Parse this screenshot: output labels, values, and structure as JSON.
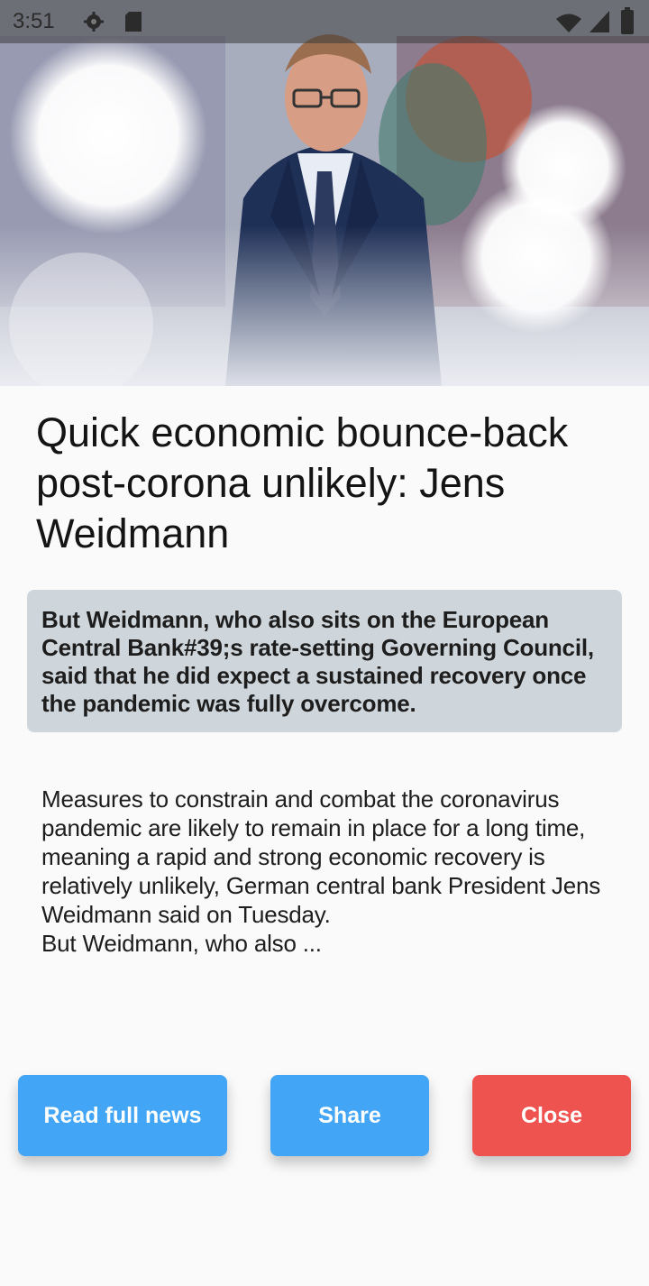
{
  "status_bar": {
    "time": "3:51",
    "icons": [
      "gear-icon",
      "sd-card-icon",
      "wifi-icon",
      "signal-icon",
      "battery-icon"
    ]
  },
  "hero": {
    "alt": "Photo of Jens Weidmann"
  },
  "article": {
    "title": "Quick economic bounce-back post-corona unlikely: Jens Weidmann",
    "highlight": "But Weidmann, who also sits on the European Central Bank#39;s rate-setting Governing Council, said that he did expect a sustained recovery once the pandemic was fully overcome.",
    "body": "Measures to constrain and combat the coronavirus pandemic are likely to remain in place for a long time, meaning a rapid and strong economic recovery is relatively unlikely, German central bank President Jens Weidmann said on Tuesday.\nBut Weidmann, who also ..."
  },
  "actions": {
    "read_full": "Read full news",
    "share": "Share",
    "close": "Close"
  },
  "colors": {
    "primary": "#42a5f5",
    "danger": "#ef5350",
    "highlight_bg": "#cfd6db",
    "background": "#fafafa"
  }
}
